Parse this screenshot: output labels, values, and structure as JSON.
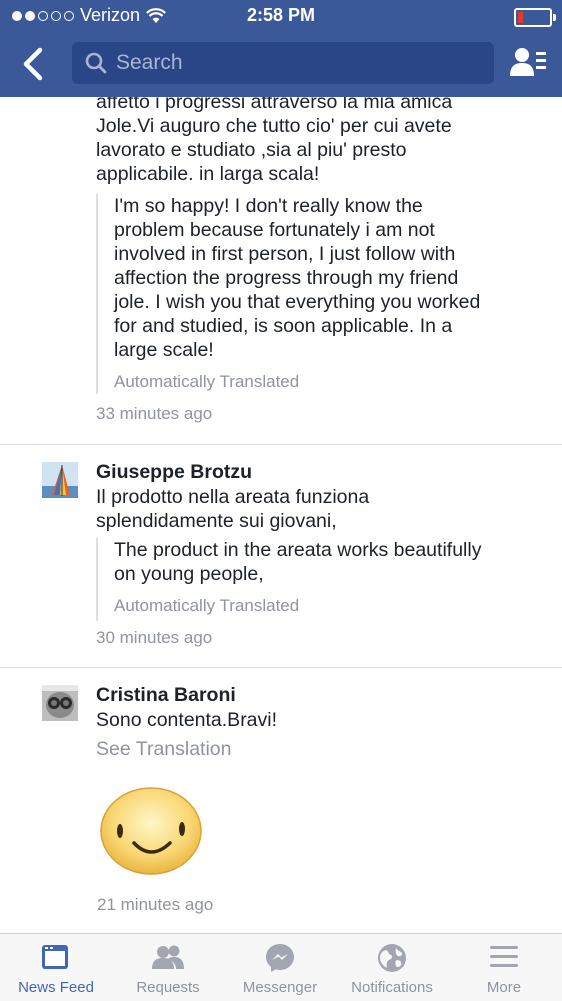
{
  "status": {
    "carrier": "Verizon",
    "time": "2:58 PM"
  },
  "header": {
    "search_placeholder": "Search"
  },
  "comments": [
    {
      "text_lines": [
        "affetto i progressi attraverso la mia amica",
        "Jole.Vi auguro che tutto cio' per cui avete",
        "lavorato e studiato ,sia al piu' presto",
        "applicabile. in larga scala!"
      ],
      "translation_lines": [
        "I'm so happy! I don't really know the",
        "problem because fortunately i am not",
        "involved in first person, I just follow with",
        "affection the progress through my friend",
        "jole. I wish you that everything you worked",
        "for and studied, is soon applicable. In a",
        "large scale!"
      ],
      "auto_label": "Automatically Translated",
      "time": "33 minutes ago"
    },
    {
      "name": "Giuseppe Brotzu",
      "text_lines": [
        "Il prodotto nella areata funziona",
        "splendidamente sui giovani,"
      ],
      "translation_lines": [
        "The product in the areata works beautifully",
        "on young people,"
      ],
      "auto_label": "Automatically Translated",
      "time": "30 minutes ago"
    },
    {
      "name": "Cristina Baroni",
      "text": "Sono contenta.Bravi!",
      "see_translation": "See Translation",
      "time": "21 minutes ago"
    }
  ],
  "tabs": [
    {
      "label": "News Feed",
      "icon": "news-feed-icon",
      "active": true
    },
    {
      "label": "Requests",
      "icon": "requests-icon"
    },
    {
      "label": "Messenger",
      "icon": "messenger-icon"
    },
    {
      "label": "Notifications",
      "icon": "notifications-icon"
    },
    {
      "label": "More",
      "icon": "more-icon"
    }
  ],
  "colors": {
    "brand": "#3b5998",
    "active_tab": "#4267b2",
    "meta": "#90949c"
  }
}
